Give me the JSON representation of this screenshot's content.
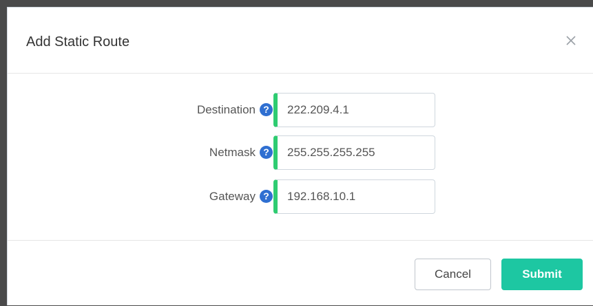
{
  "dialog": {
    "title": "Add Static Route",
    "close_icon": "close-icon"
  },
  "fields": [
    {
      "label": "Destination",
      "value": "222.209.4.1",
      "help_icon": "question-circle-icon"
    },
    {
      "label": "Netmask",
      "value": "255.255.255.255",
      "help_icon": "question-circle-icon"
    },
    {
      "label": "Gateway",
      "value": "192.168.10.1",
      "help_icon": "question-circle-icon"
    }
  ],
  "footer": {
    "cancel_label": "Cancel",
    "submit_label": "Submit"
  },
  "colors": {
    "accent_submit": "#1dc7a2",
    "field_valid_border": "#2ecc71",
    "help_icon": "#2f6fd1"
  }
}
